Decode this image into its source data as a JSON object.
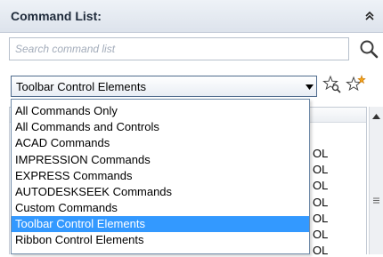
{
  "panel": {
    "title": "Command List:",
    "collapse_icon": "double-chevron-up-icon"
  },
  "search": {
    "placeholder": "Search command list",
    "icon": "magnifier-icon"
  },
  "filter": {
    "selected": "Toolbar Control Elements",
    "arrow_icon": "dropdown-arrow-icon",
    "options": [
      "All Commands Only",
      "All Commands and Controls",
      "ACAD Commands",
      "IMPRESSION Commands",
      "EXPRESS Commands",
      "AUTODESKSEEK Commands",
      "Custom Commands",
      "Toolbar Control Elements",
      "Ribbon Control Elements"
    ],
    "selected_index": 7
  },
  "toolbar": {
    "find_icon": "star-magnifier-icon",
    "new_icon": "star-new-icon"
  },
  "background_list": {
    "visible_cells": [
      "OL",
      "OL",
      "OL",
      "OL",
      "OL",
      "OL",
      "OL"
    ]
  },
  "colors": {
    "selection": "#3399ff",
    "header_bg": "#dde3ec",
    "border": "#6f8aa8"
  }
}
